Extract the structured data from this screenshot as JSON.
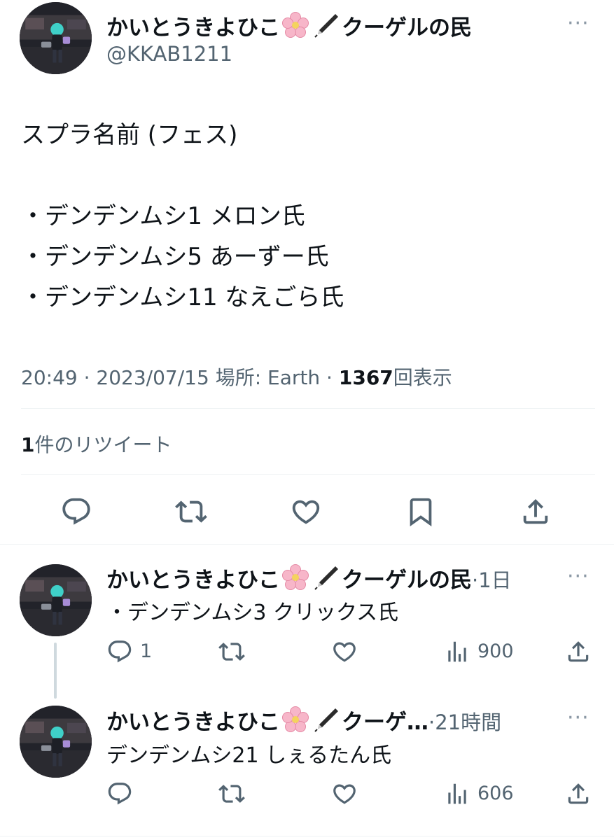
{
  "main_tweet": {
    "display_name": "かいとうきよひこ",
    "display_suffix": "クーゲルの民",
    "handle": "@KKAB1211",
    "text_lines": [
      "スプラ名前 (フェス)",
      "",
      "・デンデンムシ1 メロン氏",
      "・デンデンムシ5 あーずー氏",
      "・デンデンムシ11 なえごら氏"
    ],
    "time": "20:49",
    "date": "2023/07/15",
    "location": "場所: Earth",
    "views_count": "1367",
    "views_label": "回表示",
    "sep": "·",
    "retweet_count": "1",
    "retweet_label": "件のリツイート"
  },
  "replies": [
    {
      "display_name": "かいとうきよひこ",
      "display_suffix": "クーゲルの民",
      "time": "·1日",
      "text": "・デンデンムシ3 クリックス氏",
      "reply_count": "1",
      "views": "900"
    },
    {
      "display_name": "かいとうきよひこ",
      "display_suffix": "クーゲ…",
      "time": "·21時間",
      "text": "デンデンムシ21 しぇるたん氏",
      "reply_count": "",
      "views": "606"
    }
  ],
  "more_symbol": "···",
  "icons": {
    "emoji_1": "cherry-blossom",
    "emoji_2": "fountain-pen",
    "actions": [
      "reply",
      "retweet",
      "like",
      "bookmark",
      "share"
    ],
    "reply_actions": [
      "reply",
      "retweet",
      "like",
      "views",
      "share"
    ]
  },
  "colors": {
    "text": "#0f1419",
    "secondary": "#536471",
    "divider": "#eff3f4"
  }
}
